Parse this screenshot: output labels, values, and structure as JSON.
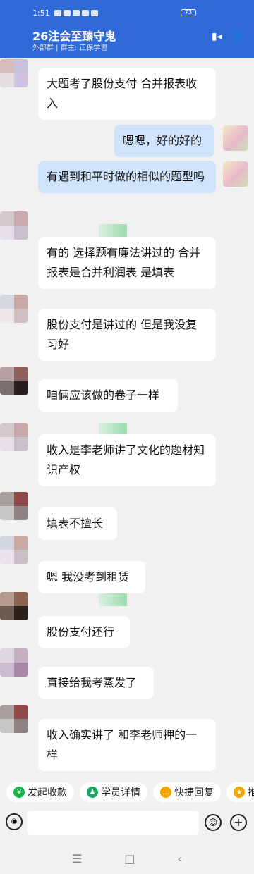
{
  "status": {
    "time": "1:51",
    "battery": "73"
  },
  "header": {
    "title": "26注会至臻守鬼",
    "subtitle": "外部群 | 群主: 正保学習"
  },
  "messages": [
    {
      "side": "left",
      "text": "大题考了股份支付 合并报表收入"
    },
    {
      "side": "right",
      "text": "嗯嗯，好的好的"
    },
    {
      "side": "right",
      "text": "有遇到和平时做的相似的题型吗"
    },
    {
      "side": "left",
      "text": "有的 选择题有廉法讲过的 合并报表是合并利润表 是填表"
    },
    {
      "side": "left",
      "text": "股份支付是讲过的 但是我没复习好"
    },
    {
      "side": "left",
      "text": "咱俩应该做的卷子一样"
    },
    {
      "side": "left",
      "text": "收入是李老师讲了文化的题材知识产权"
    },
    {
      "side": "left",
      "text": "填表不擅长"
    },
    {
      "side": "left",
      "text": "嗯 我没考到租赁"
    },
    {
      "side": "left",
      "text": "股份支付还行"
    },
    {
      "side": "left",
      "text": "直接给我考蒸发了"
    },
    {
      "side": "left",
      "text": "收入确实讲了 和李老师押的一样"
    }
  ],
  "actions": [
    {
      "label": "发起收款",
      "icon": "payment-icon",
      "color": "#19b34b"
    },
    {
      "label": "学员详情",
      "icon": "user-detail-icon",
      "color": "#1aa866"
    },
    {
      "label": "快捷回复",
      "icon": "quick-reply-icon",
      "color": "#f2a500"
    },
    {
      "label": "推荐",
      "icon": "recommend-icon",
      "color": "#f2a500"
    }
  ],
  "input": {
    "value": ""
  },
  "colors": {
    "header": "#2f6ad8",
    "bubble_right": "#cfe3fb",
    "bubble_left": "#ffffff"
  }
}
